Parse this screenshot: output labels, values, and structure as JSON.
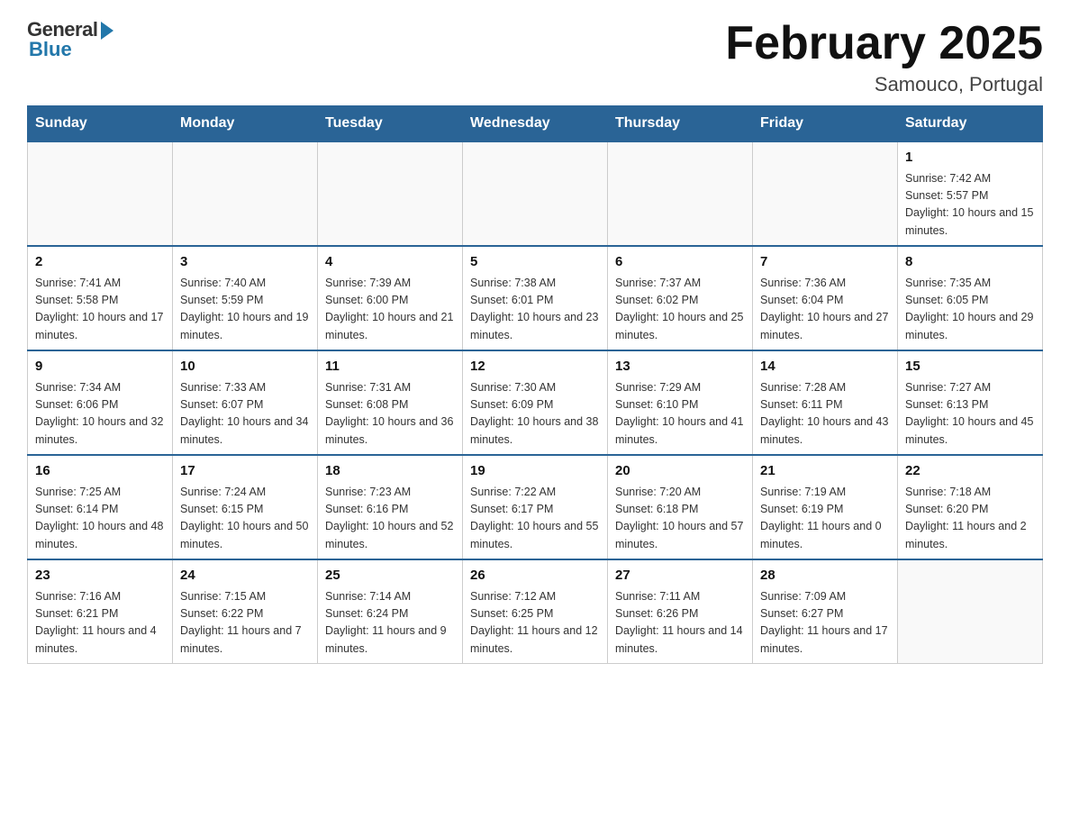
{
  "logo": {
    "general": "General",
    "blue": "Blue"
  },
  "title": "February 2025",
  "subtitle": "Samouco, Portugal",
  "days_of_week": [
    "Sunday",
    "Monday",
    "Tuesday",
    "Wednesday",
    "Thursday",
    "Friday",
    "Saturday"
  ],
  "weeks": [
    [
      {
        "day": "",
        "info": ""
      },
      {
        "day": "",
        "info": ""
      },
      {
        "day": "",
        "info": ""
      },
      {
        "day": "",
        "info": ""
      },
      {
        "day": "",
        "info": ""
      },
      {
        "day": "",
        "info": ""
      },
      {
        "day": "1",
        "info": "Sunrise: 7:42 AM\nSunset: 5:57 PM\nDaylight: 10 hours and 15 minutes."
      }
    ],
    [
      {
        "day": "2",
        "info": "Sunrise: 7:41 AM\nSunset: 5:58 PM\nDaylight: 10 hours and 17 minutes."
      },
      {
        "day": "3",
        "info": "Sunrise: 7:40 AM\nSunset: 5:59 PM\nDaylight: 10 hours and 19 minutes."
      },
      {
        "day": "4",
        "info": "Sunrise: 7:39 AM\nSunset: 6:00 PM\nDaylight: 10 hours and 21 minutes."
      },
      {
        "day": "5",
        "info": "Sunrise: 7:38 AM\nSunset: 6:01 PM\nDaylight: 10 hours and 23 minutes."
      },
      {
        "day": "6",
        "info": "Sunrise: 7:37 AM\nSunset: 6:02 PM\nDaylight: 10 hours and 25 minutes."
      },
      {
        "day": "7",
        "info": "Sunrise: 7:36 AM\nSunset: 6:04 PM\nDaylight: 10 hours and 27 minutes."
      },
      {
        "day": "8",
        "info": "Sunrise: 7:35 AM\nSunset: 6:05 PM\nDaylight: 10 hours and 29 minutes."
      }
    ],
    [
      {
        "day": "9",
        "info": "Sunrise: 7:34 AM\nSunset: 6:06 PM\nDaylight: 10 hours and 32 minutes."
      },
      {
        "day": "10",
        "info": "Sunrise: 7:33 AM\nSunset: 6:07 PM\nDaylight: 10 hours and 34 minutes."
      },
      {
        "day": "11",
        "info": "Sunrise: 7:31 AM\nSunset: 6:08 PM\nDaylight: 10 hours and 36 minutes."
      },
      {
        "day": "12",
        "info": "Sunrise: 7:30 AM\nSunset: 6:09 PM\nDaylight: 10 hours and 38 minutes."
      },
      {
        "day": "13",
        "info": "Sunrise: 7:29 AM\nSunset: 6:10 PM\nDaylight: 10 hours and 41 minutes."
      },
      {
        "day": "14",
        "info": "Sunrise: 7:28 AM\nSunset: 6:11 PM\nDaylight: 10 hours and 43 minutes."
      },
      {
        "day": "15",
        "info": "Sunrise: 7:27 AM\nSunset: 6:13 PM\nDaylight: 10 hours and 45 minutes."
      }
    ],
    [
      {
        "day": "16",
        "info": "Sunrise: 7:25 AM\nSunset: 6:14 PM\nDaylight: 10 hours and 48 minutes."
      },
      {
        "day": "17",
        "info": "Sunrise: 7:24 AM\nSunset: 6:15 PM\nDaylight: 10 hours and 50 minutes."
      },
      {
        "day": "18",
        "info": "Sunrise: 7:23 AM\nSunset: 6:16 PM\nDaylight: 10 hours and 52 minutes."
      },
      {
        "day": "19",
        "info": "Sunrise: 7:22 AM\nSunset: 6:17 PM\nDaylight: 10 hours and 55 minutes."
      },
      {
        "day": "20",
        "info": "Sunrise: 7:20 AM\nSunset: 6:18 PM\nDaylight: 10 hours and 57 minutes."
      },
      {
        "day": "21",
        "info": "Sunrise: 7:19 AM\nSunset: 6:19 PM\nDaylight: 11 hours and 0 minutes."
      },
      {
        "day": "22",
        "info": "Sunrise: 7:18 AM\nSunset: 6:20 PM\nDaylight: 11 hours and 2 minutes."
      }
    ],
    [
      {
        "day": "23",
        "info": "Sunrise: 7:16 AM\nSunset: 6:21 PM\nDaylight: 11 hours and 4 minutes."
      },
      {
        "day": "24",
        "info": "Sunrise: 7:15 AM\nSunset: 6:22 PM\nDaylight: 11 hours and 7 minutes."
      },
      {
        "day": "25",
        "info": "Sunrise: 7:14 AM\nSunset: 6:24 PM\nDaylight: 11 hours and 9 minutes."
      },
      {
        "day": "26",
        "info": "Sunrise: 7:12 AM\nSunset: 6:25 PM\nDaylight: 11 hours and 12 minutes."
      },
      {
        "day": "27",
        "info": "Sunrise: 7:11 AM\nSunset: 6:26 PM\nDaylight: 11 hours and 14 minutes."
      },
      {
        "day": "28",
        "info": "Sunrise: 7:09 AM\nSunset: 6:27 PM\nDaylight: 11 hours and 17 minutes."
      },
      {
        "day": "",
        "info": ""
      }
    ]
  ]
}
